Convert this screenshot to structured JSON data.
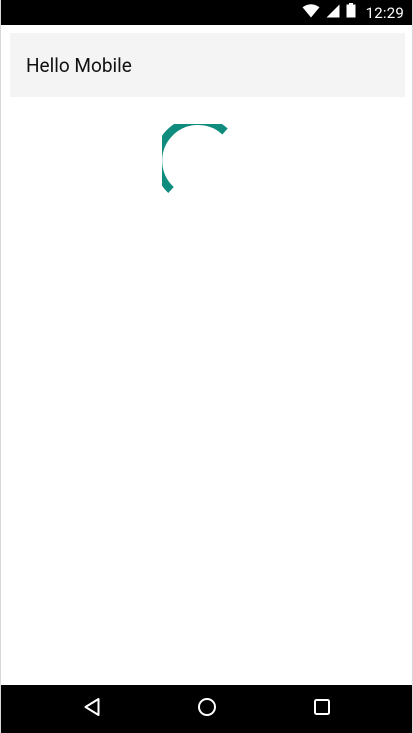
{
  "status_bar": {
    "time": "12:29",
    "icons": [
      "wifi-icon",
      "cellular-signal-icon",
      "battery-icon"
    ]
  },
  "app": {
    "title": "Hello Mobile"
  },
  "loading": {
    "icon": "loading-spinner",
    "color": "#0f8c7e"
  },
  "nav_bar": {
    "buttons": [
      "back-icon",
      "home-icon",
      "recents-icon"
    ]
  },
  "colors": {
    "status_bar_bg": "#000000",
    "header_bg": "#f4f4f4",
    "accent": "#0f8c7e"
  }
}
